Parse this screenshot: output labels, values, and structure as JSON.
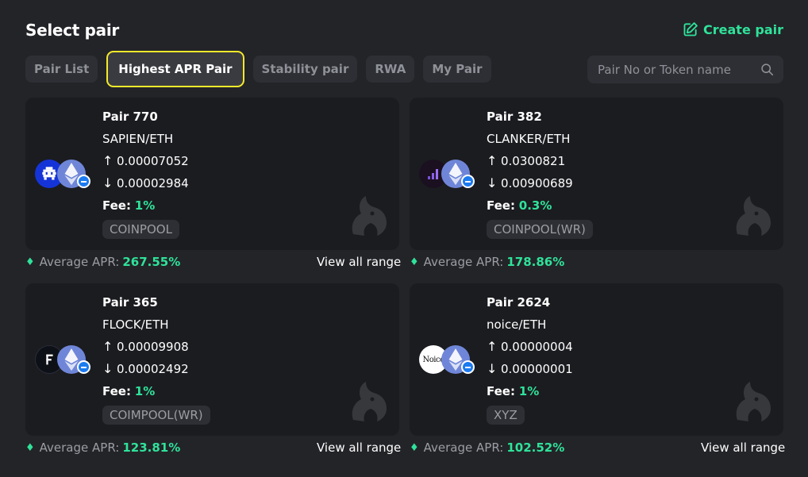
{
  "header": {
    "title": "Select pair",
    "create_label": "Create pair",
    "accent_color": "#2fe29a"
  },
  "tabs": [
    {
      "label": "Pair List"
    },
    {
      "label": "Highest APR Pair",
      "active": true
    },
    {
      "label": "Stability pair"
    },
    {
      "label": "RWA"
    },
    {
      "label": "My Pair"
    }
  ],
  "search": {
    "placeholder": "Pair No or Token name",
    "value": ""
  },
  "common": {
    "fee_label": "Fee:",
    "apr_label": "Average APR:",
    "view_label": "View all range",
    "up_arrow": "↑",
    "down_arrow": "↓",
    "diamond": "♦"
  },
  "pairs": [
    {
      "pair_no": "Pair 770",
      "name": "SAPIEN/ETH",
      "up_price": "0.00007052",
      "down_price": "0.00002984",
      "fee": "1%",
      "pool": "COINPOOL",
      "apr": "267.55%",
      "token_icon": "sapien-icon"
    },
    {
      "pair_no": "Pair 382",
      "name": "CLANKER/ETH",
      "up_price": "0.0300821",
      "down_price": "0.00900689",
      "fee": "0.3%",
      "pool": "COINPOOL(WR)",
      "apr": "178.86%",
      "token_icon": "clanker-icon"
    },
    {
      "pair_no": "Pair 365",
      "name": "FLOCK/ETH",
      "up_price": "0.00009908",
      "down_price": "0.00002492",
      "fee": "1%",
      "pool": "COIMPOOL(WR)",
      "apr": "123.81%",
      "token_icon": "flock-icon"
    },
    {
      "pair_no": "Pair 2624",
      "name": "noice/ETH",
      "up_price": "0.00000004",
      "down_price": "0.00000001",
      "fee": "1%",
      "pool": "XYZ",
      "apr": "102.52%",
      "token_icon": "noice-icon",
      "token_logo_text": "Noice"
    }
  ]
}
